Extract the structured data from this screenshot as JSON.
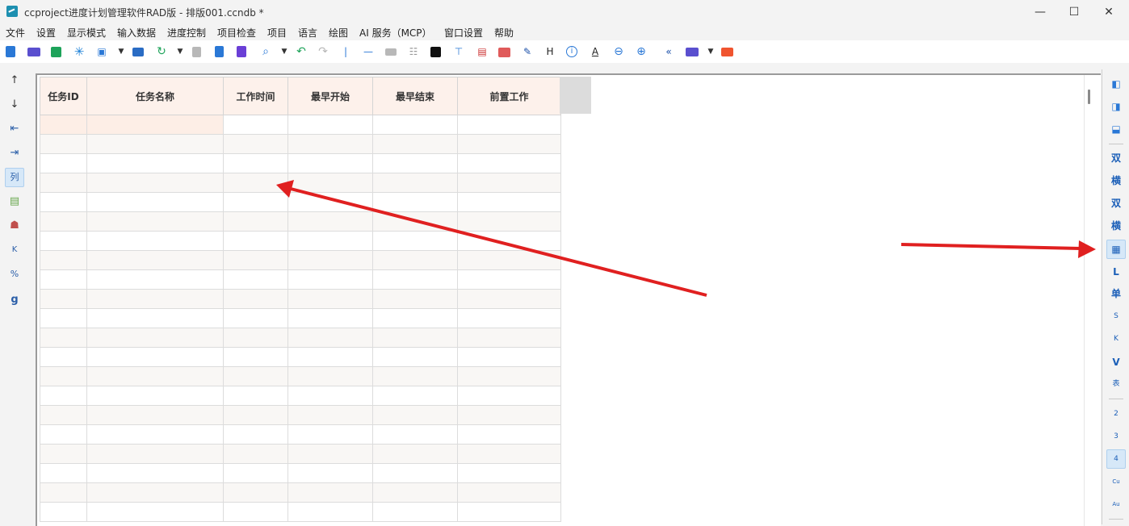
{
  "window": {
    "title": "ccproject进度计划管理软件RAD版 - 排版001.ccndb *",
    "minimize": "—",
    "maximize": "☐",
    "close": "✕"
  },
  "menu": [
    "文件",
    "设置",
    "显示模式",
    "输入数据",
    "进度控制",
    "项目检查",
    "项目",
    "语言",
    "绘图",
    "AI 服务（MCP）",
    "窗口设置",
    "帮助"
  ],
  "toolbar_icons": [
    "new-file-icon",
    "open-folder-icon",
    "save-icon",
    "asterisk-icon",
    "export-image-icon",
    "dropdown-arrow-icon",
    "print-icon",
    "refresh-icon",
    "dropdown-arrow-icon",
    "copy-icon",
    "paste-icon",
    "format-painter-icon",
    "search-icon",
    "dropdown-arrow-icon",
    "undo-icon",
    "redo-icon",
    "vertical-line-icon",
    "horizontal-line-icon",
    "block-icon",
    "distribute-icon",
    "contrast-icon",
    "paint-roller-icon",
    "report-icon",
    "palette-icon",
    "edit-doc-icon",
    "h-text-icon",
    "info-icon",
    "text-a-icon",
    "zoom-out-icon",
    "zoom-in-icon",
    "back-arrows-icon",
    "folder-open-icon",
    "dropdown-arrow-icon",
    "red-folder-icon"
  ],
  "toolbar_text": {
    "h": "H",
    "i": "i",
    "a": "A"
  },
  "left_tools": {
    "move_up": "↑",
    "move_down": "↓",
    "outdent": "⇤",
    "indent": "⇥",
    "column": "列",
    "notes": "▤",
    "people": "☗",
    "k": "K",
    "percent": "%",
    "g": "g"
  },
  "table": {
    "columns": [
      "任务ID",
      "任务名称",
      "工作时间",
      "最早开始",
      "最早结束",
      "前置工作"
    ],
    "row_count": 21
  },
  "right_tools": [
    "双",
    "横",
    "双",
    "横",
    "▦",
    "L",
    "单",
    "S",
    "K",
    "V",
    "表",
    "2",
    "3",
    "4",
    "Cu",
    "Au"
  ],
  "colors": {
    "accent": "#1b5fb8",
    "header_bg": "#fdf1eb",
    "annotation_arrow": "#e02020"
  }
}
